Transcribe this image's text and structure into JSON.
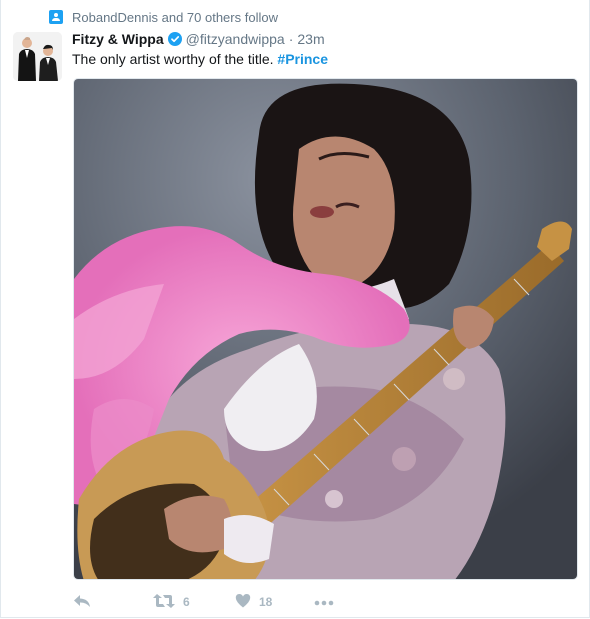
{
  "context": {
    "text": "RobandDennis and 70 others follow",
    "icon": "follow-context-icon"
  },
  "author": {
    "fullname": "Fitzy & Wippa",
    "screenname": "@fitzyandwippa",
    "separator": "·",
    "time": "23m",
    "verified": true,
    "avatar_icon": "profile-avatar"
  },
  "tweet": {
    "text": "The only artist worthy of the title.",
    "hashtag": "#Prince"
  },
  "actions": {
    "reply_icon": "reply-icon",
    "retweet_icon": "retweet-icon",
    "retweet_count": "6",
    "like_icon": "heart-icon",
    "like_count": "18",
    "more_icon": "more-dots-icon"
  },
  "colors": {
    "accent": "#1da1f2",
    "hashtag": "#1b95e0",
    "muted": "#657786",
    "action": "#aab8c2",
    "boa": "#f07ec6"
  }
}
